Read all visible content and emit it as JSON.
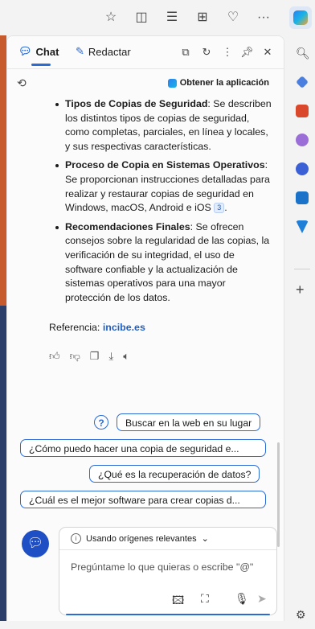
{
  "header": {
    "tab_chat": "Chat",
    "tab_redactar": "Redactar",
    "get_app": "Obtener la aplicación"
  },
  "content": {
    "bullets": [
      {
        "title": "Tipos de Copias de Seguridad",
        "text": ": Se describen los distintos tipos de copias de seguridad, como completas, parciales, en línea y locales, y sus respectivas características."
      },
      {
        "title": "Proceso de Copia en Sistemas Operativos",
        "text": ": Se proporcionan instrucciones detalladas para realizar y restaurar copias de seguridad en Windows, macOS, Android e iOS",
        "cite": "3",
        "after": "."
      },
      {
        "title": "Recomendaciones Finales",
        "text": ": Se ofrecen consejos sobre la regularidad de las copias, la verificación de su integridad, el uso de software confiable y la actualización de sistemas operativos para una mayor protección de los datos."
      }
    ],
    "reference_label": "Referencia: ",
    "reference_link": "incibe.es"
  },
  "suggestions": {
    "web_search": "Buscar en la web en su lugar",
    "q1": "¿Cómo puedo hacer una copia de seguridad e...",
    "q2": "¿Qué es la recuperación de datos?",
    "q3": "¿Cuál es el mejor software para crear copias d..."
  },
  "input": {
    "sources_label": "Usando orígenes relevantes",
    "placeholder": "Pregúntame lo que quieras o escribe \"@\""
  },
  "colors": {
    "accent": "#2b6cd4",
    "newchat": "#1f4fc4"
  }
}
